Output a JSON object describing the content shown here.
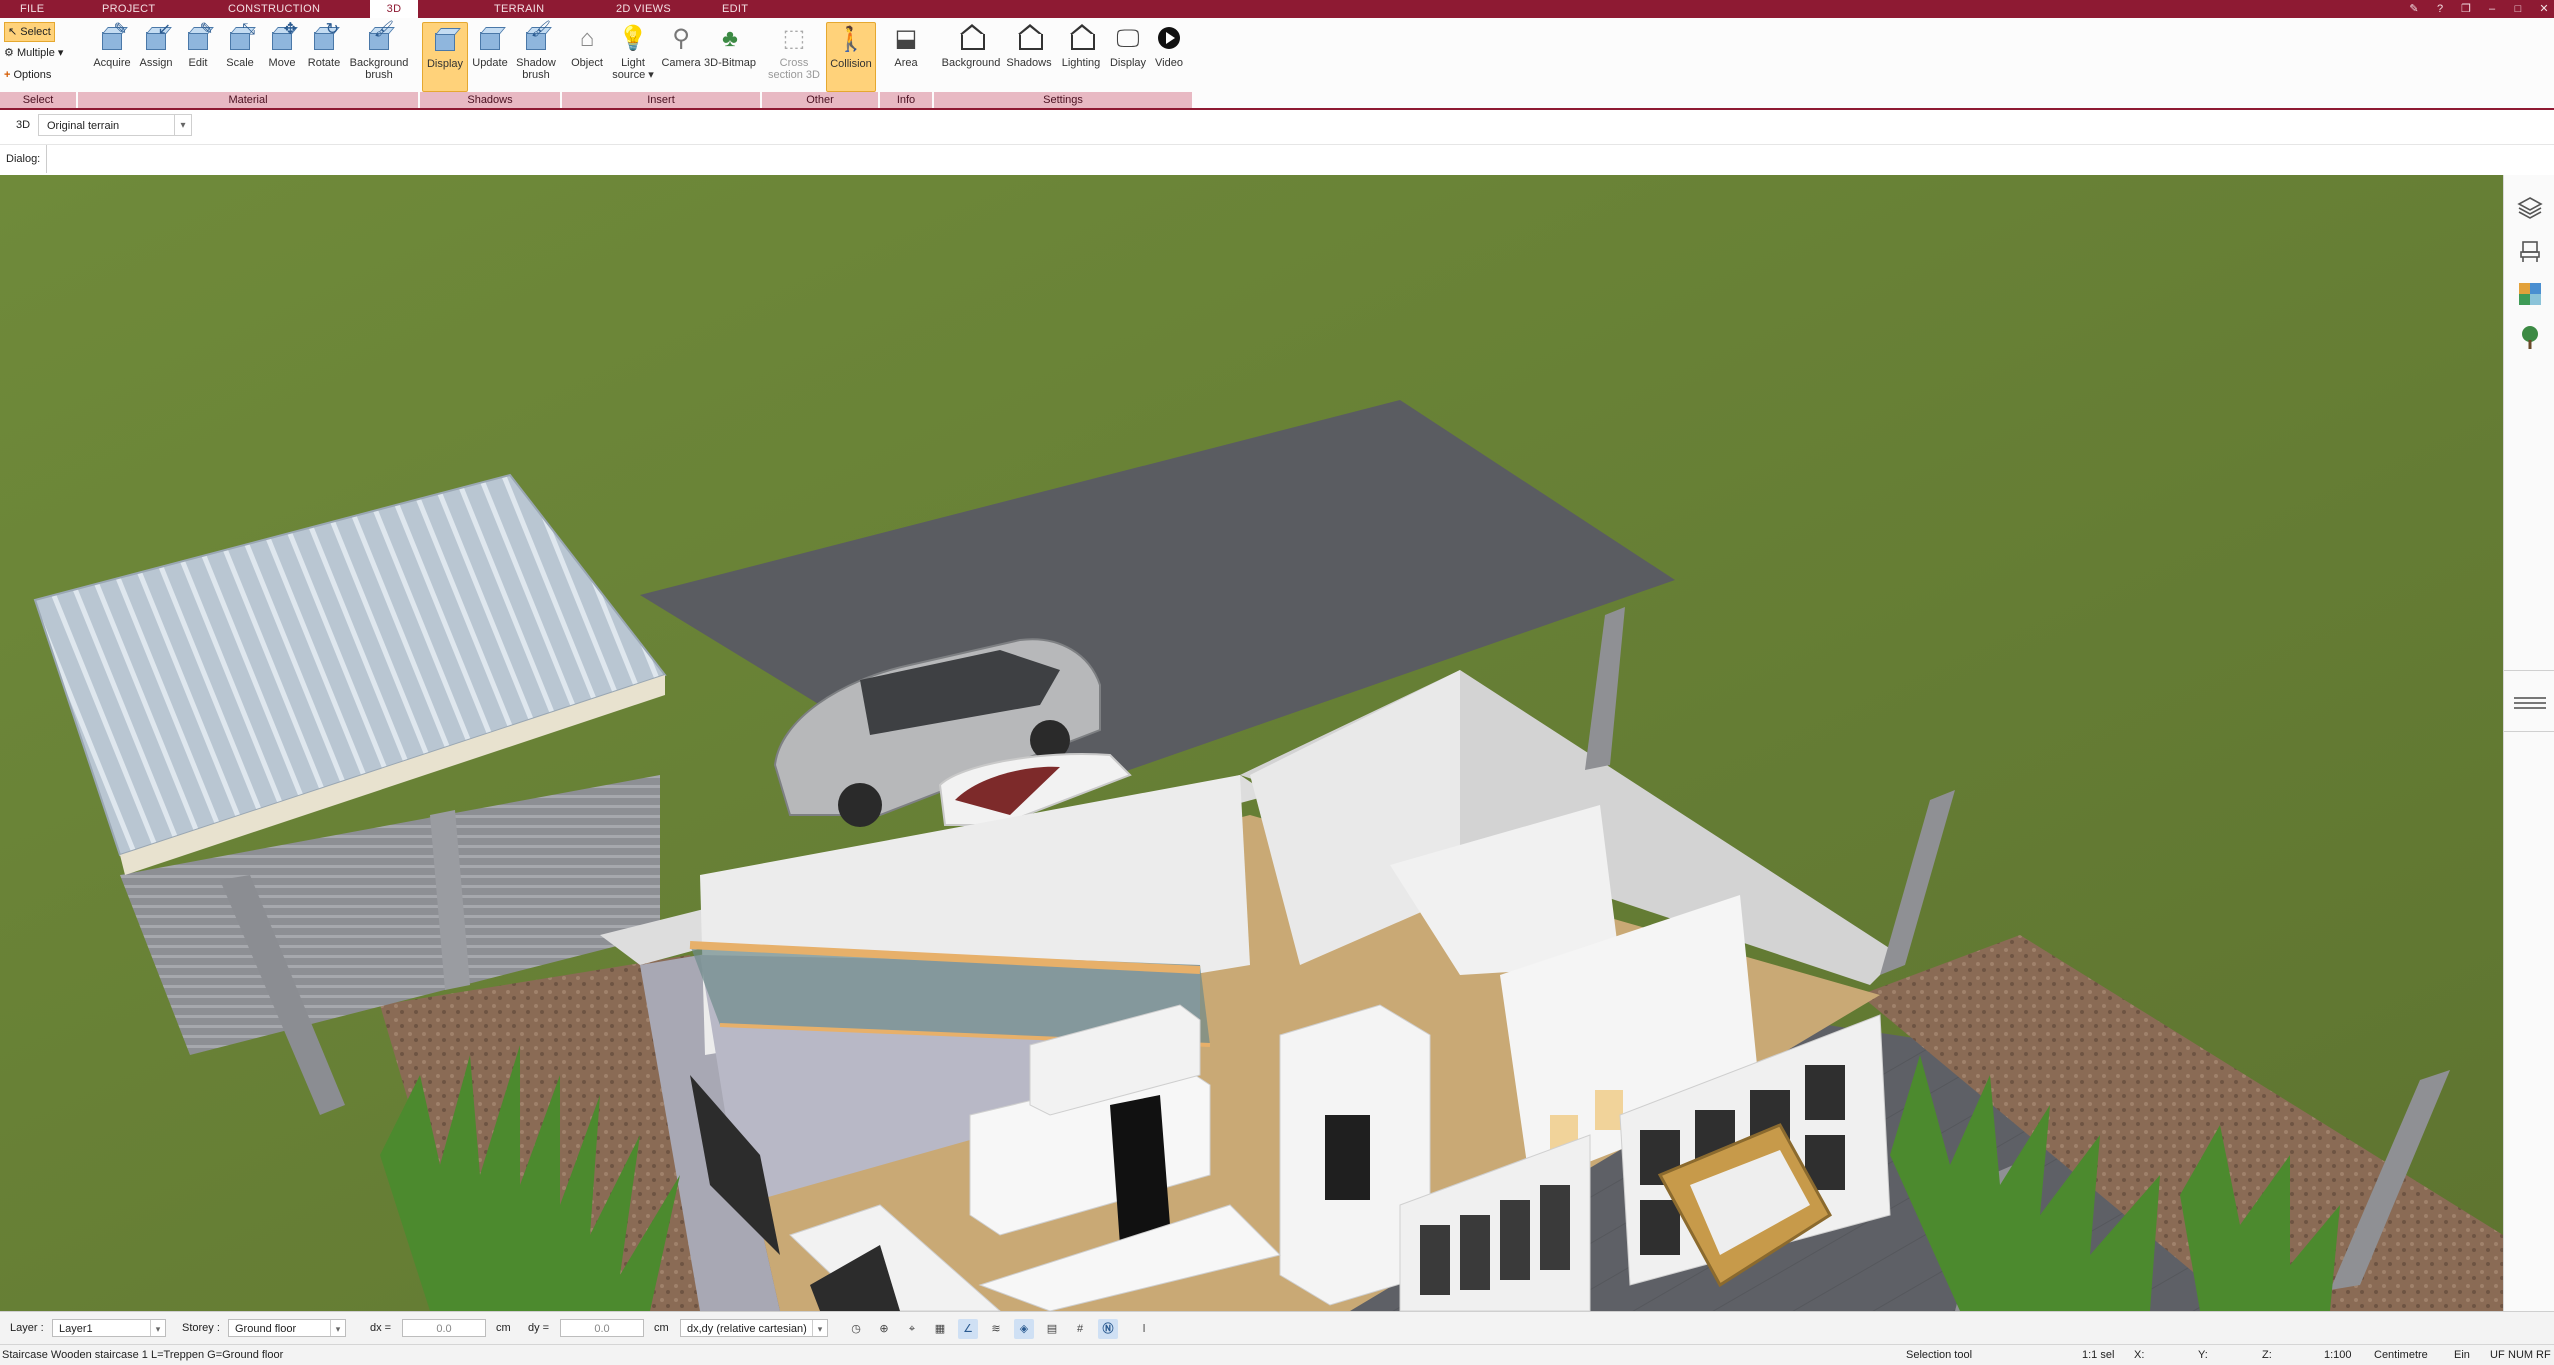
{
  "tabs": [
    {
      "label": "FILE"
    },
    {
      "label": "PROJECT"
    },
    {
      "label": "CONSTRUCTION"
    },
    {
      "label": "3D"
    },
    {
      "label": "TERRAIN"
    },
    {
      "label": "2D VIEWS"
    },
    {
      "label": "EDIT"
    }
  ],
  "active_tab": "3D",
  "ribbon": {
    "select_group": {
      "select_label": "Select",
      "multiple_label": "Multiple",
      "options_label": "Options",
      "group_label": "Select"
    },
    "material_group": {
      "label": "Material",
      "buttons": [
        "Acquire",
        "Assign",
        "Edit",
        "Scale",
        "Move",
        "Rotate",
        "Background brush"
      ]
    },
    "shadows_group": {
      "label": "Shadows",
      "buttons": [
        "Display",
        "Update",
        "Shadow brush"
      ]
    },
    "insert_group": {
      "label": "Insert",
      "buttons": [
        "Object",
        "Light source",
        "Camera",
        "3D-Bitmap"
      ]
    },
    "other_group": {
      "label": "Other",
      "buttons": [
        "Cross section 3D",
        "Collision"
      ]
    },
    "info_group": {
      "label": "Info",
      "buttons": [
        "Area"
      ]
    },
    "settings_group": {
      "label": "Settings",
      "buttons": [
        "Background",
        "Shadows",
        "Lighting",
        "Display",
        "Video"
      ]
    }
  },
  "viewbar": {
    "mode_label": "3D",
    "terrain_value": "Original terrain"
  },
  "dialog": {
    "label": "Dialog:"
  },
  "status1": {
    "layer_label": "Layer :",
    "layer_value": "Layer1",
    "storey_label": "Storey :",
    "storey_value": "Ground floor",
    "dx_label": "dx =",
    "dx_value": "0.0",
    "dx_unit": "cm",
    "dy_label": "dy =",
    "dy_value": "0.0",
    "dy_unit": "cm",
    "coord_mode": "dx,dy (relative cartesian)"
  },
  "status2": {
    "object_info": "Staircase Wooden staircase 1 L=Treppen G=Ground floor",
    "tool": "Selection tool",
    "scale_sel": "1:1 sel",
    "x_label": "X:",
    "y_label": "Y:",
    "z_label": "Z:",
    "scale": "1:100",
    "unit": "Centimetre",
    "ein": "Ein",
    "uf": "UF",
    "num": "NUM",
    "rf": "RF"
  },
  "colors": {
    "brand": "#8e1a33",
    "group_label_bg": "#e8b9c3",
    "active_button": "#ffd27a",
    "lawn": "#6b7d3a"
  },
  "icons": {
    "right_rail": [
      "layers-icon",
      "chair-icon",
      "material-palette-icon",
      "tree-icon"
    ]
  }
}
